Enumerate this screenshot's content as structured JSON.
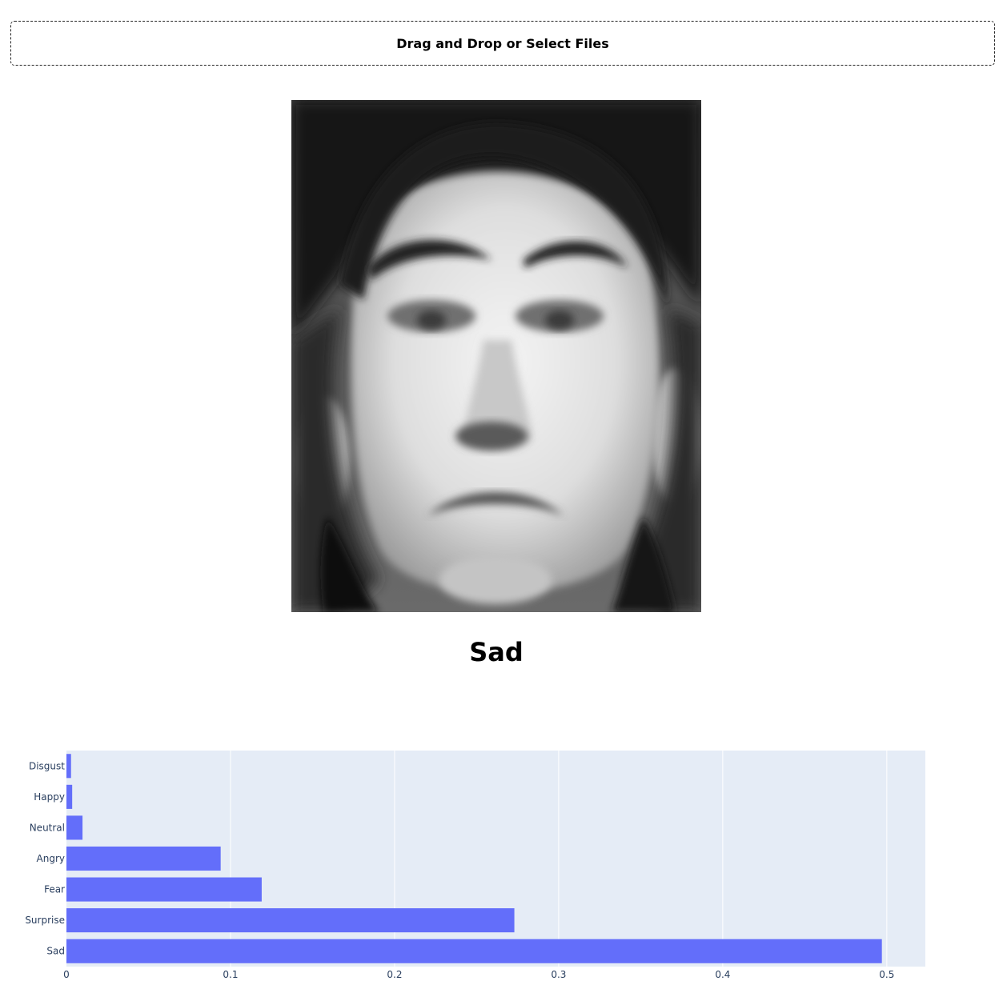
{
  "upload": {
    "label": "Drag and Drop or Select Files"
  },
  "photo": {
    "icon": "face-photo"
  },
  "prediction": {
    "label": "Sad"
  },
  "colors": {
    "bar": "#636efa",
    "plot_bg": "#e5ecf6",
    "grid": "#ffffff",
    "tick_text": "#2a3f5f"
  },
  "chart_data": {
    "type": "bar",
    "orientation": "horizontal",
    "categories": [
      "Disgust",
      "Happy",
      "Neutral",
      "Angry",
      "Fear",
      "Surprise",
      "Sad"
    ],
    "values": [
      0.0028,
      0.0035,
      0.0098,
      0.094,
      0.119,
      0.273,
      0.497
    ],
    "xlim": [
      0,
      0.5235
    ],
    "xticks": [
      0,
      0.1,
      0.2,
      0.3,
      0.4,
      0.5
    ],
    "xtick_labels": [
      "0",
      "0.1",
      "0.2",
      "0.3",
      "0.4",
      "0.5"
    ],
    "grid": true
  }
}
